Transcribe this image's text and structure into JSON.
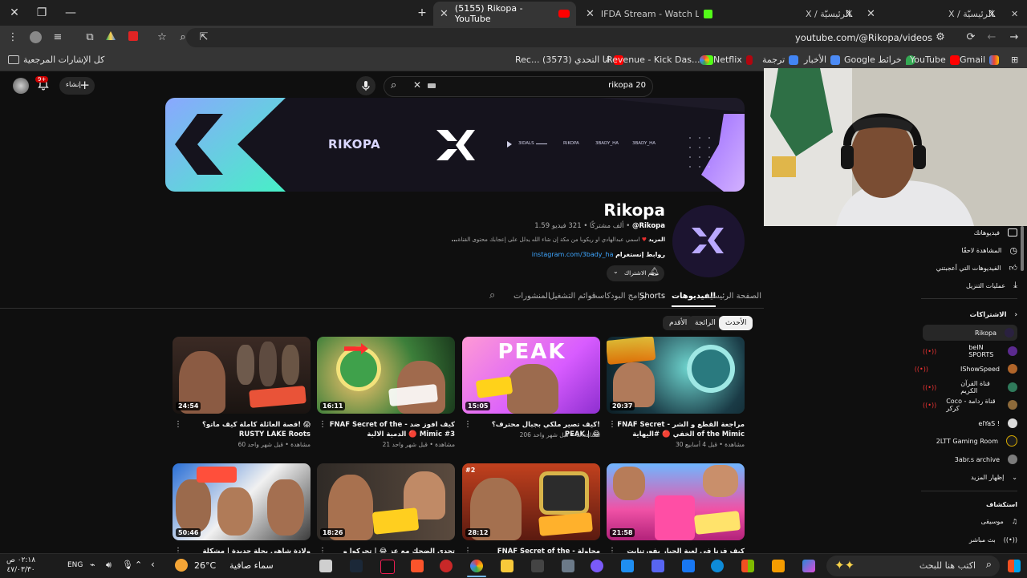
{
  "browser": {
    "tabs": [
      {
        "title": "(5155) Rikopa - YouTube",
        "active": true
      },
      {
        "title": "IFDA Stream - Watch Live on Kick",
        "active": false
      },
      {
        "title": "X / الرئيسيّة",
        "active": false
      },
      {
        "title": "X / الرئيسيّة",
        "active": false
      }
    ],
    "url": "youtube.com/@Rikopa/videos",
    "bookmarks": [
      "كل الإشارات المرجعية",
      "Rec... (3573) انا التحدي",
      "Revenue - Kick Das...",
      "Netflix",
      "ترجمة",
      "الأخبار",
      "Google خرائط",
      "YouTube",
      "Gmail"
    ]
  },
  "yt": {
    "search_value": "rikopa 20",
    "create_label": "إنشاء",
    "notif_count": "9+"
  },
  "banner": {
    "wordmark": "RIKOPA",
    "socials": [
      "3IDALS",
      "RIKOPA",
      "3BADY_HA",
      "3BADY_HA"
    ]
  },
  "channel": {
    "name": "Rikopa",
    "meta_handle": "@Rikopa",
    "meta_stats": "1.59 ألف مشتركًا • 321 فيديو",
    "description": "اسمي عبدالهادي او ريكوبا من مكة إن شاء الله يدلل على إعجابك محتوى القناة",
    "more": "...المزيد",
    "link_prefix": "روابط إنستغرام",
    "link_url": "instagram.com/3bady_ha",
    "subscribe_label": "تم الاشتراك"
  },
  "channel_tabs": [
    "الصفحة الرئيسية",
    "الفيديوهات",
    "Shorts",
    "برامج البودكاست",
    "قوائم التشغيل",
    "المنشورات"
  ],
  "chips": [
    "الأحدث",
    "الرائجة",
    "الأقدم"
  ],
  "videos": [
    {
      "duration": "20:37",
      "title": "FNAF Secret - مراجعة القطع و الشر الخفي 🔴 #اليهاية of the Mimic",
      "meta": "30 مشاهدة • قبل 4 أسابيع"
    },
    {
      "duration": "15:05",
      "title": "كيف تصير ملكي بجبال محترف؟! PEAK | 😂",
      "meta": "206 مشاهدات • قبل شهر واحد"
    },
    {
      "duration": "16:11",
      "title": "FNAF Secret of the - كيف افوز ضد الدمية الالية 🔴 Mimic #3",
      "meta": "21 مشاهدة • قبل شهر واحد"
    },
    {
      "duration": "24:54",
      "title": "قصة العائلة كاملة كيف ماتو؟! 😱 RUSTY LAKE Roots",
      "meta": "60 مشاهدة • قبل شهر واحد"
    },
    {
      "duration": "21:58",
      "title": "كيف فزنا في لعبة الحبار بفورتنايت مع جيين رايدن!",
      "meta": ""
    },
    {
      "duration": "28:12",
      "title": "FNAF Secret of the - محاولة الهروب من القطار 😱",
      "meta": ""
    },
    {
      "duration": "18:26",
      "title": "تحدي الضحك مع عز 😂 | تحركوا و الميرة",
      "meta": ""
    },
    {
      "duration": "50:46",
      "title": "ولادة شاهي بحلة جديدة | مشكلة الحارس مع ماهركوا؟",
      "meta": ""
    }
  ],
  "sidebar": {
    "you_items": [
      "فيديوهاتك",
      "المشاهدة لاحقًا",
      "الفيديوهات التي أعجبتني",
      "عمليات التنزيل"
    ],
    "subs_header": "الاشتراكات",
    "subs": [
      "Rikopa",
      "beIN SPORTS",
      "IShowSpeed",
      "قناة القرآن الكريم",
      "Coco قناة ردامة - كركر",
      "elYaS !",
      "2LTT Gaming Room",
      "3abr.s archive",
      "إظهار المزيد"
    ],
    "explore_header": "استكشاف",
    "explore": [
      "موسيقى",
      "بث مباشر"
    ]
  },
  "taskbar": {
    "search_placeholder": "اكتب هنا للبحث",
    "weather_temp": "26°C",
    "weather_desc": "سماء صافية",
    "lang": "ENG",
    "time": "٠٢:١٨ ص",
    "date": "٤٧/٠٣/٣٠"
  }
}
